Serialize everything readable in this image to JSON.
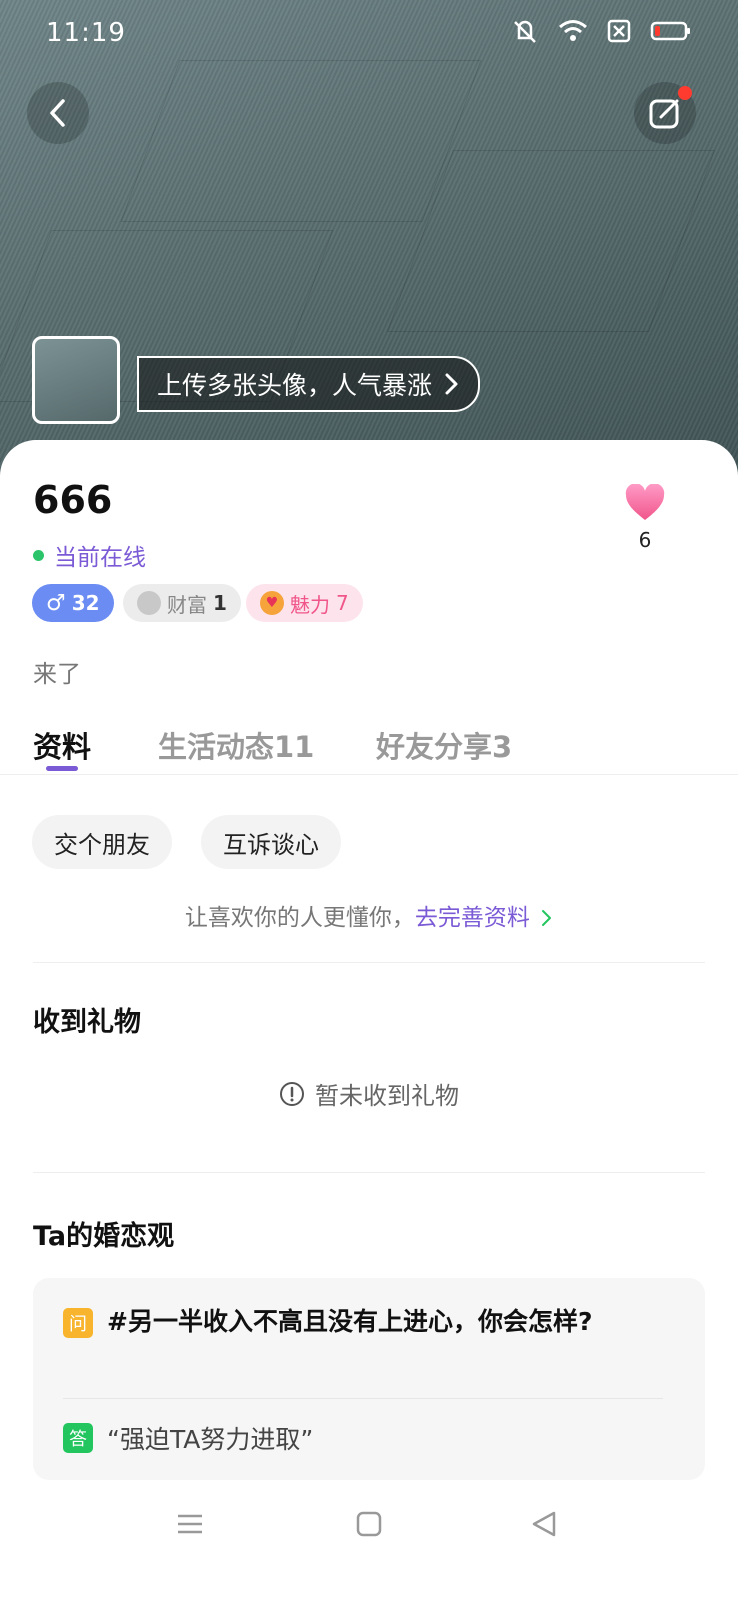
{
  "status_bar": {
    "time": "11:19"
  },
  "profile": {
    "upload_hint": "上传多张头像，人气暴涨",
    "name": "666",
    "online_status": "当前在线",
    "likes": "6",
    "badges": {
      "age": "32",
      "wealth_label": "财富",
      "wealth_value": "1",
      "charm_label": "魅力",
      "charm_value": "7"
    },
    "signature": "来了"
  },
  "tabs": [
    {
      "label": "资料",
      "active": true
    },
    {
      "label": "生活动态11",
      "active": false
    },
    {
      "label": "好友分享3",
      "active": false
    }
  ],
  "interests": [
    "交个朋友",
    "互诉谈心"
  ],
  "prompt": {
    "text": "让喜欢你的人更懂你，",
    "link": "去完善资料"
  },
  "gifts": {
    "title": "收到礼物",
    "empty_text": "暂未收到礼物"
  },
  "marriage_view": {
    "title": "Ta的婚恋观",
    "question_tag": "问",
    "question": "#另一半收入不高且没有上进心，你会怎样?",
    "answer_tag": "答",
    "answer": "“强迫TA努力进取”"
  },
  "colors": {
    "accent": "#7b5ad6",
    "online": "#2bc46a",
    "age_badge": "#6b8cf2",
    "charm": "#f0568a",
    "question_tag": "#f7b42c",
    "answer_tag": "#22c55e"
  }
}
